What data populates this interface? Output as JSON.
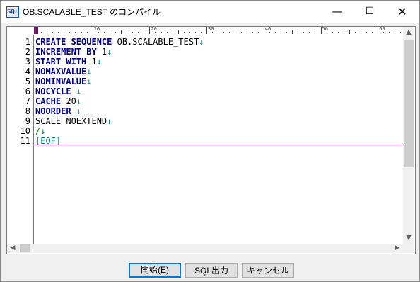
{
  "window": {
    "title": "OB.SCALABLE_TEST のコンパイル",
    "icon": "sql-icon",
    "controls": {
      "minimize": "—",
      "maximize": "☐",
      "close": "✕"
    }
  },
  "ruler": {
    "labels": [
      "0",
      "10",
      "20",
      "30",
      "40",
      "50",
      "60"
    ]
  },
  "editor": {
    "lines": [
      {
        "num": "1",
        "parts": [
          {
            "t": "CREATE SEQUENCE",
            "c": "kw"
          },
          {
            "t": " OB.SCALABLE_TEST",
            "c": "plain"
          },
          {
            "t": "↓",
            "c": "eol"
          }
        ]
      },
      {
        "num": "2",
        "parts": [
          {
            "t": "INCREMENT BY",
            "c": "kw"
          },
          {
            "t": " 1",
            "c": "plain"
          },
          {
            "t": "↓",
            "c": "eol"
          }
        ]
      },
      {
        "num": "3",
        "parts": [
          {
            "t": "START WITH",
            "c": "kw"
          },
          {
            "t": " 1",
            "c": "plain"
          },
          {
            "t": "↓",
            "c": "eol"
          }
        ]
      },
      {
        "num": "4",
        "parts": [
          {
            "t": "NOMAXVALUE",
            "c": "kw"
          },
          {
            "t": "↓",
            "c": "eol"
          }
        ]
      },
      {
        "num": "5",
        "parts": [
          {
            "t": "NOMINVALUE",
            "c": "kw"
          },
          {
            "t": "↓",
            "c": "eol"
          }
        ]
      },
      {
        "num": "6",
        "parts": [
          {
            "t": "NOCYCLE",
            "c": "kw"
          },
          {
            "t": " ↓",
            "c": "eol"
          }
        ]
      },
      {
        "num": "7",
        "parts": [
          {
            "t": "CACHE",
            "c": "kw"
          },
          {
            "t": " 20",
            "c": "plain"
          },
          {
            "t": "↓",
            "c": "eol"
          }
        ]
      },
      {
        "num": "8",
        "parts": [
          {
            "t": "NOORDER",
            "c": "kw"
          },
          {
            "t": " ↓",
            "c": "eol"
          }
        ]
      },
      {
        "num": "9",
        "parts": [
          {
            "t": "SCALE NOEXTEND",
            "c": "plain"
          },
          {
            "t": "↓",
            "c": "eol"
          }
        ]
      },
      {
        "num": "10",
        "parts": [
          {
            "t": "/",
            "c": "slash"
          },
          {
            "t": "↓",
            "c": "eol"
          }
        ]
      },
      {
        "num": "11",
        "parts": [
          {
            "t": "[EOF]",
            "c": "eof"
          }
        ]
      }
    ]
  },
  "buttons": {
    "start": "開始(E)",
    "sql_output": "SQL出力",
    "cancel": "キャンセル"
  },
  "colors": {
    "keyword": "#000080",
    "eol_marker": "#008080",
    "eof_line": "#800080",
    "default_button_border": "#0078d7"
  }
}
